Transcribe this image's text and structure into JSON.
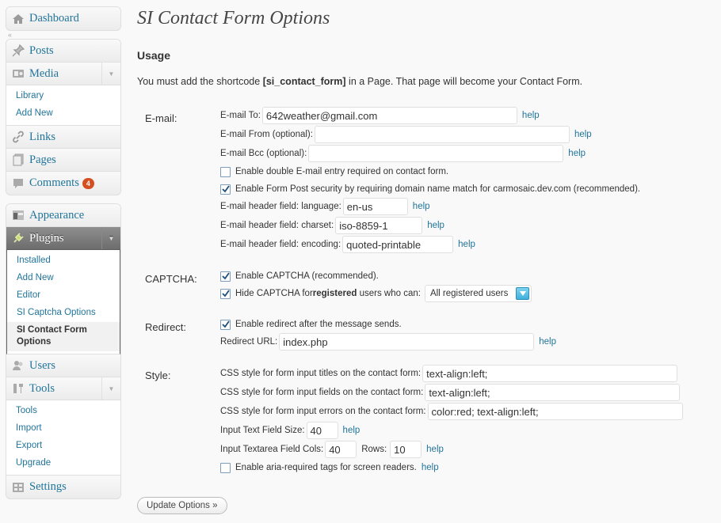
{
  "menu": {
    "dashboard": "Dashboard",
    "posts": "Posts",
    "media": "Media",
    "media_sub": [
      "Library",
      "Add New"
    ],
    "links": "Links",
    "pages": "Pages",
    "comments": "Comments",
    "comments_count": "4",
    "appearance": "Appearance",
    "plugins": "Plugins",
    "plugins_sub": [
      "Installed",
      "Add New",
      "Editor",
      "SI Captcha Options"
    ],
    "plugins_current_line1": "SI Contact Form",
    "plugins_current_line2": "Options",
    "users": "Users",
    "tools": "Tools",
    "tools_sub": [
      "Tools",
      "Import",
      "Export",
      "Upgrade"
    ],
    "settings": "Settings"
  },
  "page": {
    "title": "SI Contact Form Options",
    "usage_heading": "Usage",
    "usage_pre": "You must add the shortcode ",
    "usage_code": "[si_contact_form]",
    "usage_post": " in a Page. That page will become your Contact Form."
  },
  "help": "help",
  "email": {
    "section": "E-mail:",
    "to_label": "E-mail To:",
    "to_value": "642weather@gmail.com",
    "from_label": "E-mail From (optional):",
    "from_value": "",
    "bcc_label": "E-mail Bcc (optional):",
    "bcc_value": "",
    "double_label": "Enable double E-mail entry required on contact form.",
    "double_checked": false,
    "security_label": "Enable Form Post security by requiring domain name match for carmosaic.dev.com (recommended).",
    "security_checked": true,
    "lang_label": "E-mail header field: language:",
    "lang_value": "en-us",
    "charset_label": "E-mail header field: charset:",
    "charset_value": "iso-8859-1",
    "encoding_label": "E-mail header field: encoding:",
    "encoding_value": "quoted-printable"
  },
  "captcha": {
    "section": "CAPTCHA:",
    "enable_label": "Enable CAPTCHA (recommended).",
    "enable_checked": true,
    "hide_pre": "Hide CAPTCHA for ",
    "hide_bold": "registered",
    "hide_post": " users who can:",
    "hide_checked": true,
    "hide_select": "All registered users"
  },
  "redirect": {
    "section": "Redirect:",
    "enable_label": "Enable redirect after the message sends.",
    "enable_checked": true,
    "url_label": "Redirect URL:",
    "url_value": "index.php"
  },
  "style": {
    "section": "Style:",
    "titles_label": "CSS style for form input titles on the contact form:",
    "titles_value": "text-align:left;",
    "fields_label": "CSS style for form input fields on the contact form:",
    "fields_value": "text-align:left;",
    "errors_label": "CSS style for form input errors on the contact form:",
    "errors_value": "color:red; text-align:left;",
    "size_label": "Input Text Field Size:",
    "size_value": "40",
    "cols_label": "Input Textarea Field Cols:",
    "cols_value": "40",
    "rows_label": "Rows:",
    "rows_value": "10",
    "aria_label": "Enable aria-required tags for screen readers.",
    "aria_checked": false
  },
  "update_button": "Update Options »"
}
